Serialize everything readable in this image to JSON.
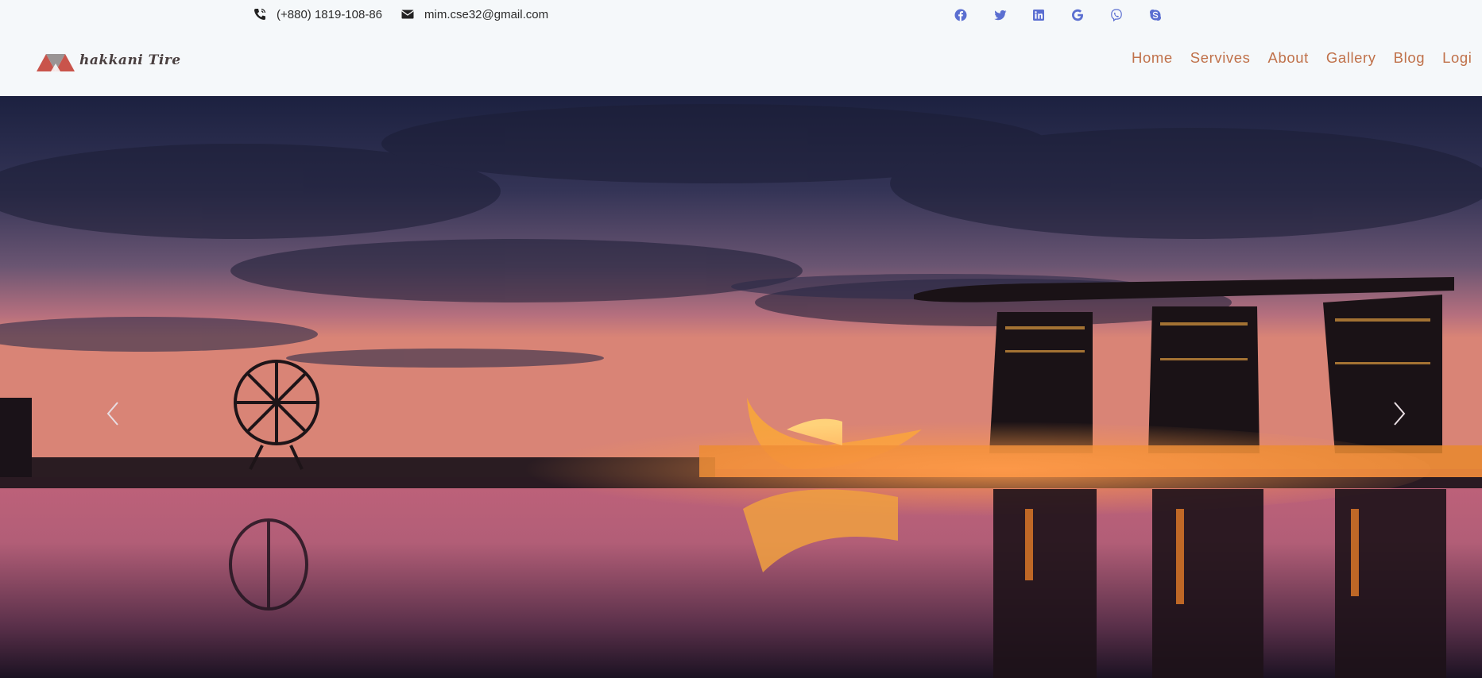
{
  "topbar": {
    "phone": {
      "icon": "phone-icon",
      "text": "(+880) 1819-108-86"
    },
    "email": {
      "icon": "envelope-icon",
      "text": "mim.cse32@gmail.com"
    },
    "social": [
      {
        "name": "facebook",
        "icon": "facebook-icon"
      },
      {
        "name": "twitter",
        "icon": "twitter-icon"
      },
      {
        "name": "linkedin",
        "icon": "linkedin-icon"
      },
      {
        "name": "google",
        "icon": "google-icon"
      },
      {
        "name": "viber",
        "icon": "viber-icon"
      },
      {
        "name": "skype",
        "icon": "skype-icon"
      }
    ],
    "social_color": "#5b6fd1"
  },
  "logo": {
    "text": "hakkani Tire",
    "colors": {
      "red": "#c9544b",
      "grey": "#9a9494"
    }
  },
  "nav": {
    "items": [
      "Home",
      "Servives",
      "About",
      "Gallery",
      "Blog",
      "Logi"
    ],
    "color": "#c0714a"
  },
  "hero": {
    "image": "city-skyline-night-photo",
    "prev_icon": "chevron-left-icon",
    "next_icon": "chevron-right-icon"
  }
}
